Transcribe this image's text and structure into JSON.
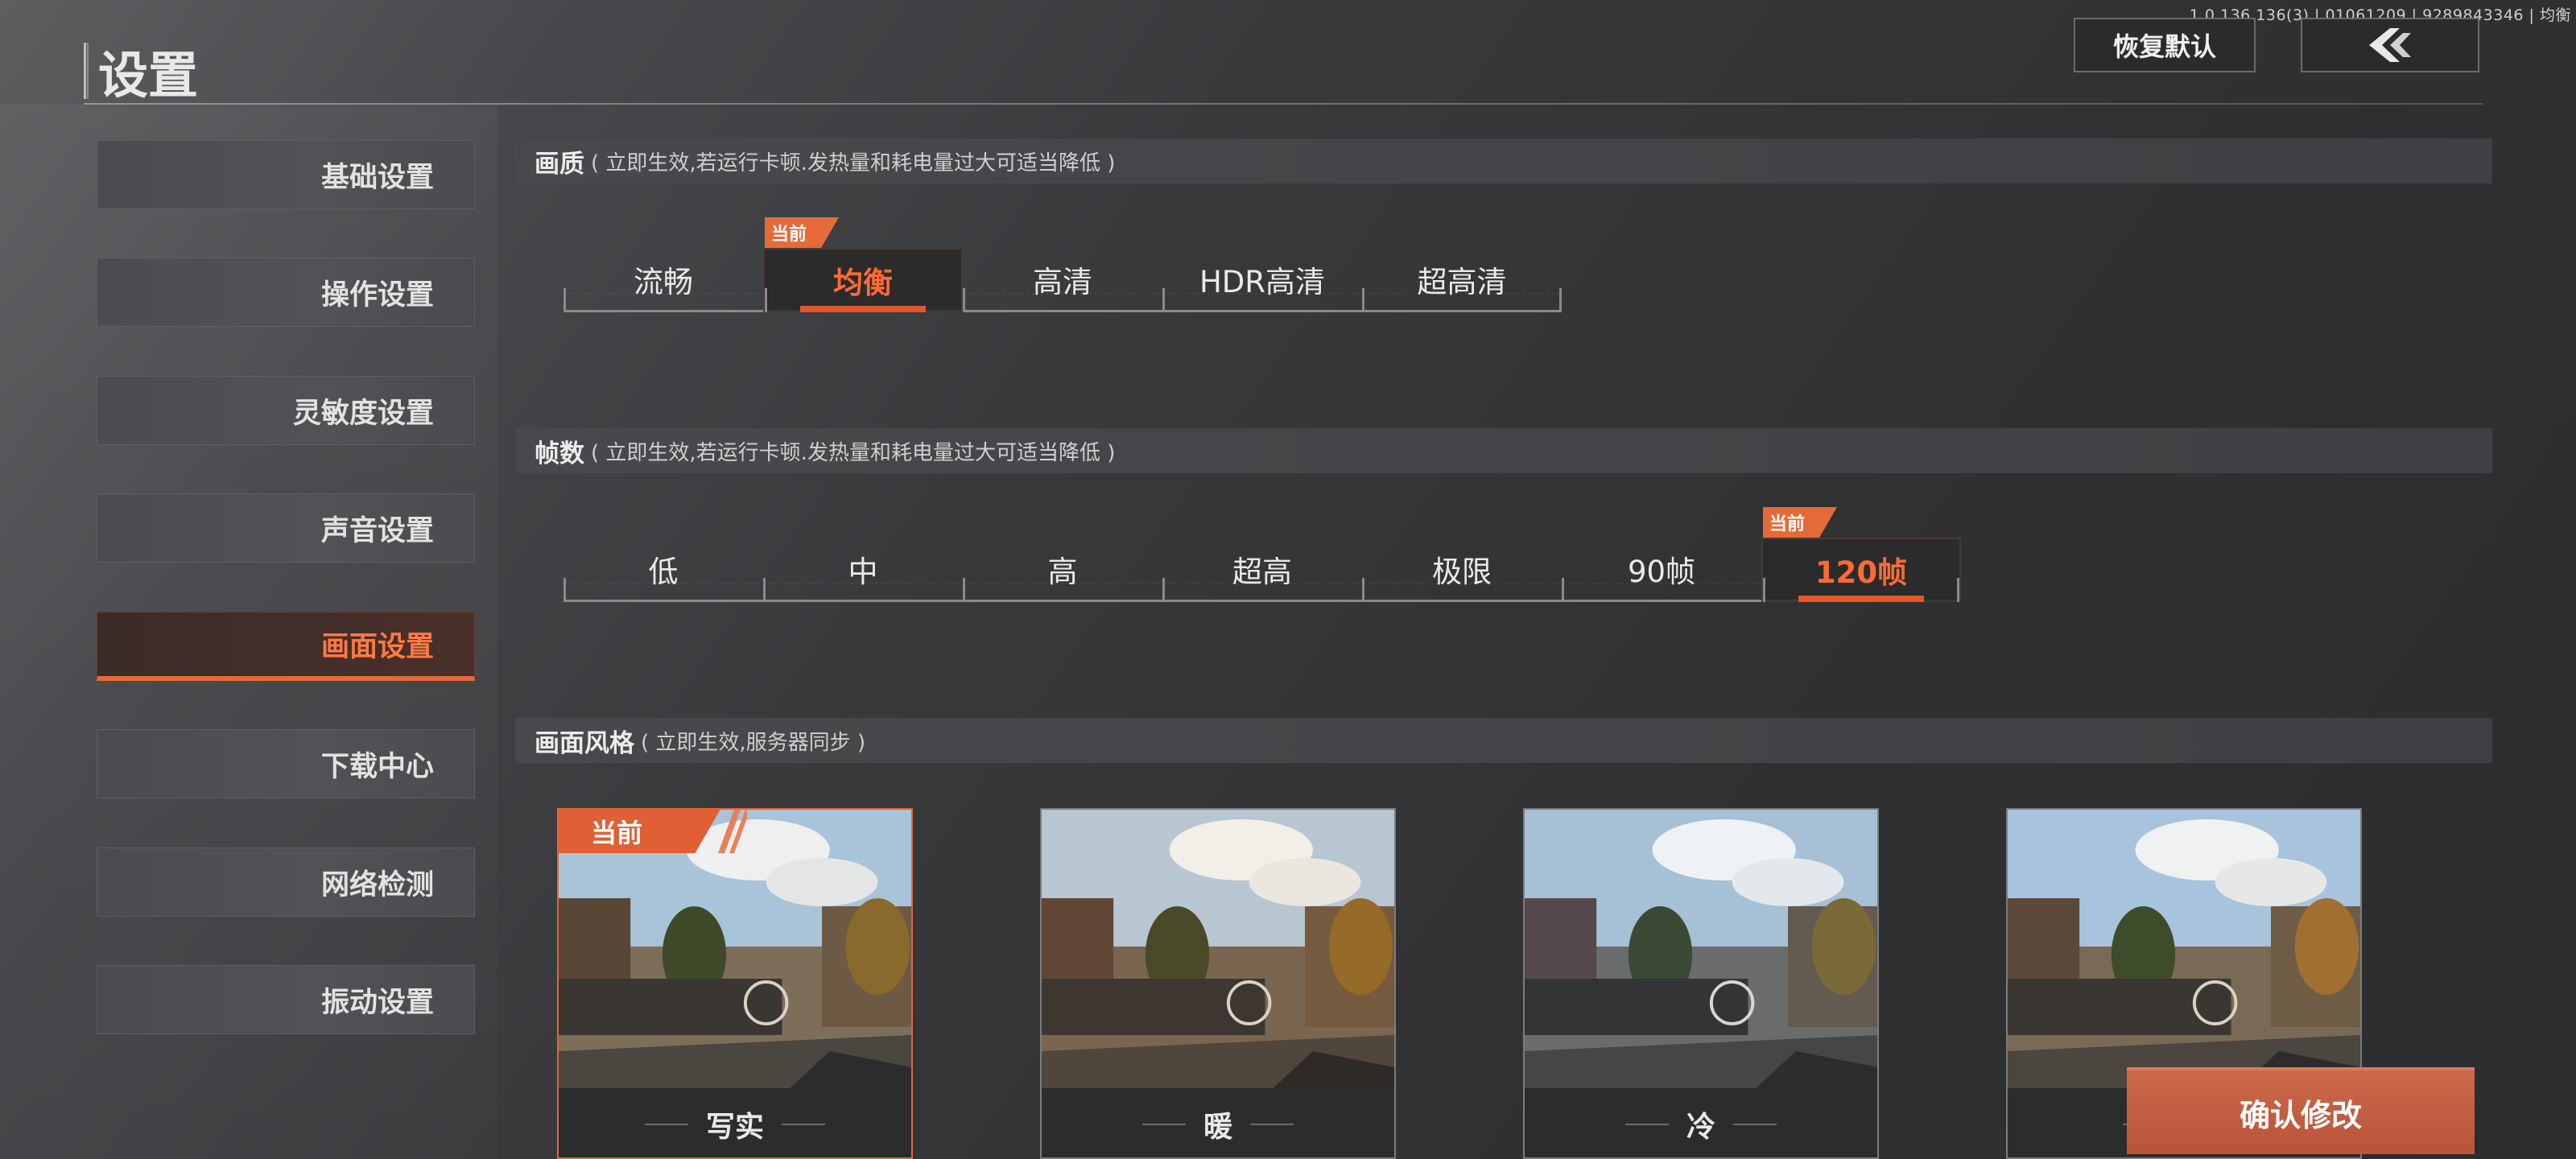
{
  "version": "1.0.136.136(3) | 01061209 | 9289843346 | 均衡",
  "header": {
    "title": "设置",
    "reset_label": "恢复默认",
    "back_icon": "chevron-left-icon"
  },
  "sidebar": {
    "items": [
      {
        "label": "基础设置",
        "active": false
      },
      {
        "label": "操作设置",
        "active": false
      },
      {
        "label": "灵敏度设置",
        "active": false
      },
      {
        "label": "声音设置",
        "active": false
      },
      {
        "label": "画面设置",
        "active": true
      },
      {
        "label": "下载中心",
        "active": false
      },
      {
        "label": "网络检测",
        "active": false
      },
      {
        "label": "振动设置",
        "active": false
      }
    ]
  },
  "quality": {
    "title": "画质",
    "note": "( 立即生效,若运行卡顿.发热量和耗电量过大可适当降低 )",
    "current_tag": "当前",
    "options": [
      "流畅",
      "均衡",
      "高清",
      "HDR高清",
      "超高清"
    ],
    "selected": "均衡"
  },
  "framerate": {
    "title": "帧数",
    "note": "( 立即生效,若运行卡顿.发热量和耗电量过大可适当降低 )",
    "current_tag": "当前",
    "options": [
      "低",
      "中",
      "高",
      "超高",
      "极限",
      "90帧",
      "120帧"
    ],
    "selected": "120帧"
  },
  "style": {
    "title": "画面风格",
    "note": "( 立即生效,服务器同步 )",
    "current_tag": "当前",
    "cards": [
      "写实",
      "暖",
      "冷",
      ""
    ],
    "selected": "写实"
  },
  "confirm_label": "确认修改",
  "colors": {
    "accent": "#e5572a",
    "accent_text": "#ff6a35",
    "panel": "#3e4043"
  }
}
